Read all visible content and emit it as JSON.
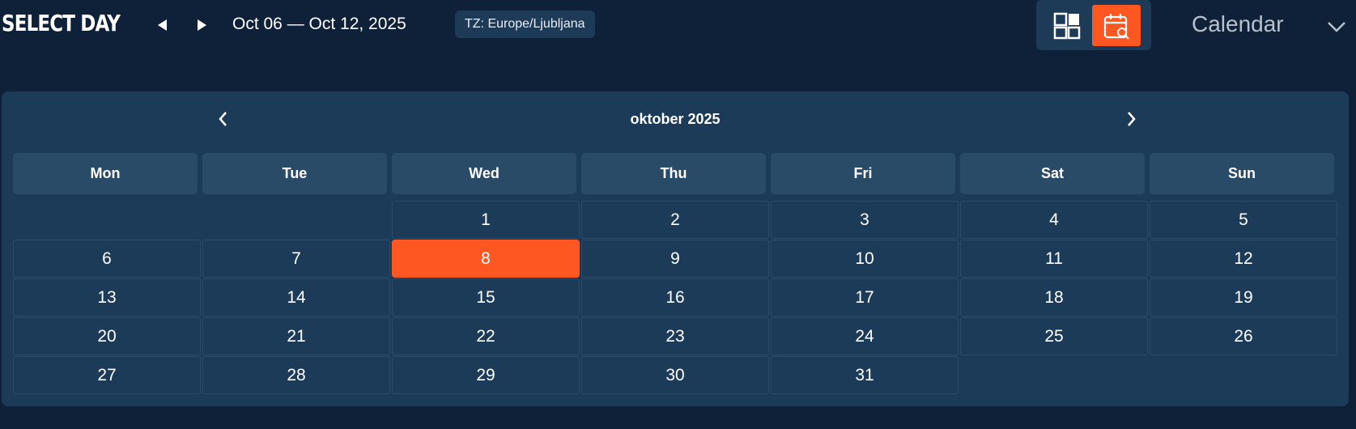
{
  "header": {
    "title": "SELECT DAY",
    "prev_icon": "triangle-left-icon",
    "next_icon": "triangle-right-icon",
    "date_range": "Oct 06 — Oct 12, 2025",
    "timezone": "TZ: Europe/Ljubljana",
    "view_selector": "Calendar",
    "views": [
      {
        "icon": "grid-layout-icon",
        "active": false
      },
      {
        "icon": "calendar-search-icon",
        "active": true
      }
    ]
  },
  "calendar": {
    "month_label": "oktober 2025",
    "weekdays": [
      "Mon",
      "Tue",
      "Wed",
      "Thu",
      "Fri",
      "Sat",
      "Sun"
    ],
    "weeks": [
      [
        "",
        "",
        "1",
        "2",
        "3",
        "4",
        "5"
      ],
      [
        "6",
        "7",
        "8",
        "9",
        "10",
        "11",
        "12"
      ],
      [
        "13",
        "14",
        "15",
        "16",
        "17",
        "18",
        "19"
      ],
      [
        "20",
        "21",
        "22",
        "23",
        "24",
        "25",
        "26"
      ],
      [
        "27",
        "28",
        "29",
        "30",
        "31",
        "",
        ""
      ]
    ],
    "selected_day": "8"
  },
  "colors": {
    "background": "#0f2139",
    "panel": "#1b3b58",
    "accent": "#ff5722",
    "weekday_header": "#2a4b68"
  }
}
